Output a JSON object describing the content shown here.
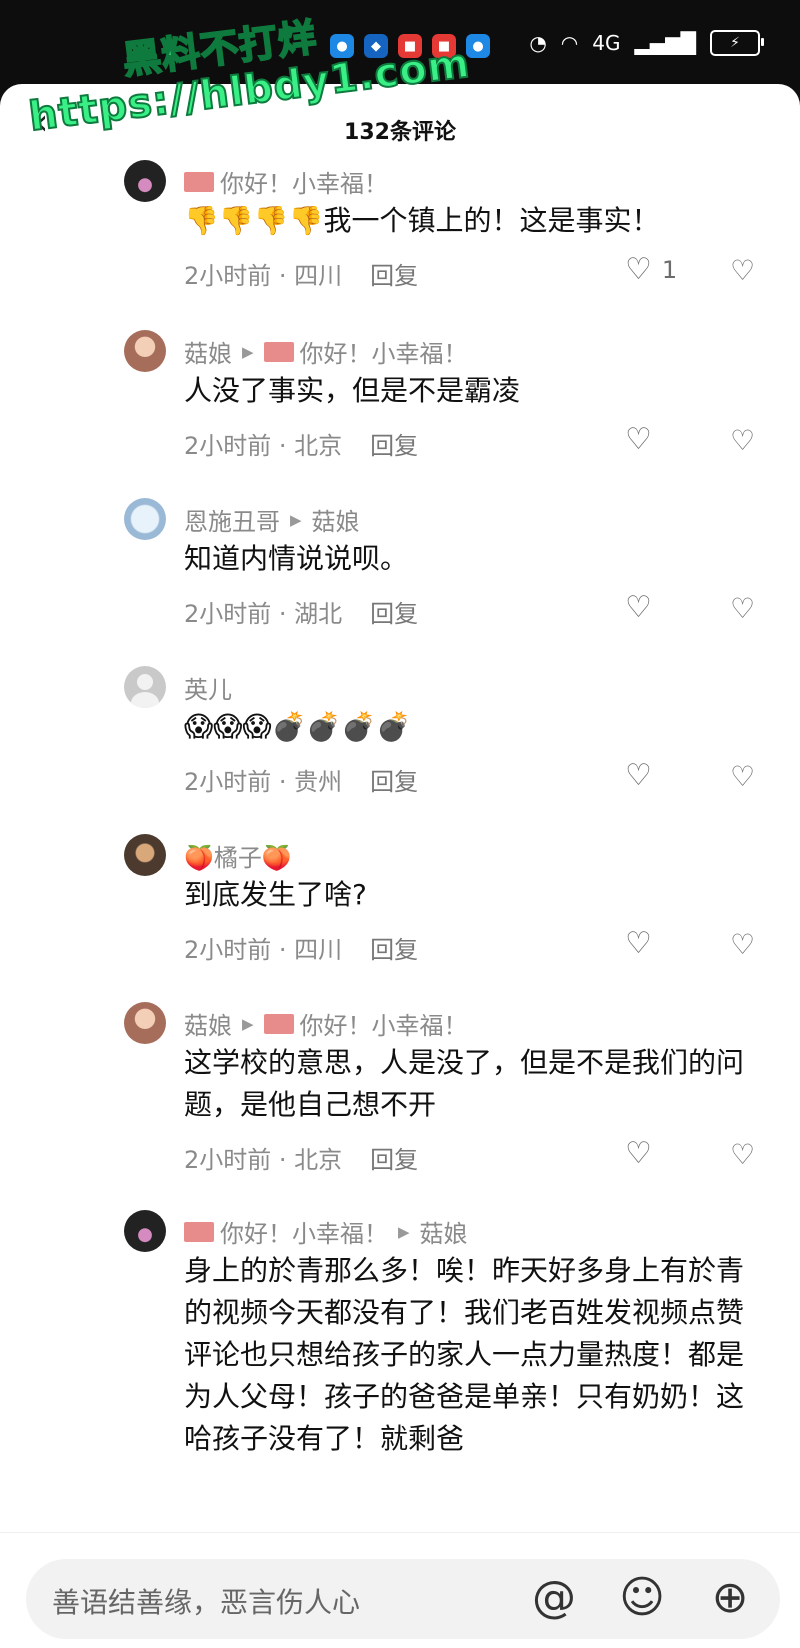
{
  "watermark": {
    "line1": "黑料不打烊",
    "line2": "https://hlbdy1.com"
  },
  "status_bar": {
    "app_icons": [
      "message-icon",
      "shield-icon",
      "app-red-icon",
      "app-red2-icon",
      "app-blue-icon"
    ],
    "network": "4G"
  },
  "header": {
    "title": "132条评论"
  },
  "comments": [
    {
      "avatar_icon": "avatar-dark",
      "author": "你好！小幸福！",
      "author_flag": true,
      "reply_to": "",
      "text": "👎👎👎👎我一个镇上的！这是事实！",
      "time": "2小时前",
      "location": "四川",
      "reply_label": "回复",
      "likes": "1"
    },
    {
      "avatar_icon": "avatar-girl",
      "author": "菇娘",
      "author_flag": false,
      "reply_to": "你好！小幸福！",
      "reply_to_flag": true,
      "text": "人没了事实，但是不是霸凌",
      "time": "2小时前",
      "location": "北京",
      "reply_label": "回复",
      "likes": ""
    },
    {
      "avatar_icon": "avatar-winter",
      "author": "恩施丑哥",
      "author_flag": false,
      "reply_to": "菇娘",
      "text": "知道内情说说呗。",
      "time": "2小时前",
      "location": "湖北",
      "reply_label": "回复",
      "likes": ""
    },
    {
      "avatar_icon": "avatar-default",
      "author": "英儿",
      "author_flag": false,
      "reply_to": "",
      "text": "😱😱😱💣💣💣💣",
      "time": "2小时前",
      "location": "贵州",
      "reply_label": "回复",
      "likes": ""
    },
    {
      "avatar_icon": "avatar-brown",
      "author": "🍑橘子🍑",
      "author_flag": false,
      "reply_to": "",
      "text": "到底发生了啥?",
      "time": "2小时前",
      "location": "四川",
      "reply_label": "回复",
      "likes": ""
    },
    {
      "avatar_icon": "avatar-girl",
      "author": "菇娘",
      "author_flag": false,
      "reply_to": "你好！小幸福！",
      "reply_to_flag": true,
      "text": "这学校的意思，人是没了，但是不是我们的问题，是他自己想不开",
      "time": "2小时前",
      "location": "北京",
      "reply_label": "回复",
      "likes": ""
    },
    {
      "avatar_icon": "avatar-dark",
      "author": "你好！小幸福！",
      "author_flag": true,
      "reply_to": "菇娘",
      "text": "身上的於青那么多！唉！昨天好多身上有於青的视频今天都没有了！我们老百姓发视频点赞评论也只想给孩子的家人一点力量热度！都是为人父母！孩子的爸爸是单亲！只有奶奶！这哈孩子没有了！就剩爸",
      "time": "",
      "location": "",
      "reply_label": "",
      "likes": ""
    }
  ],
  "input": {
    "placeholder": "善语结善缘，恶言伤人心",
    "icons": [
      "at-icon",
      "emoji-icon",
      "add-icon"
    ]
  }
}
